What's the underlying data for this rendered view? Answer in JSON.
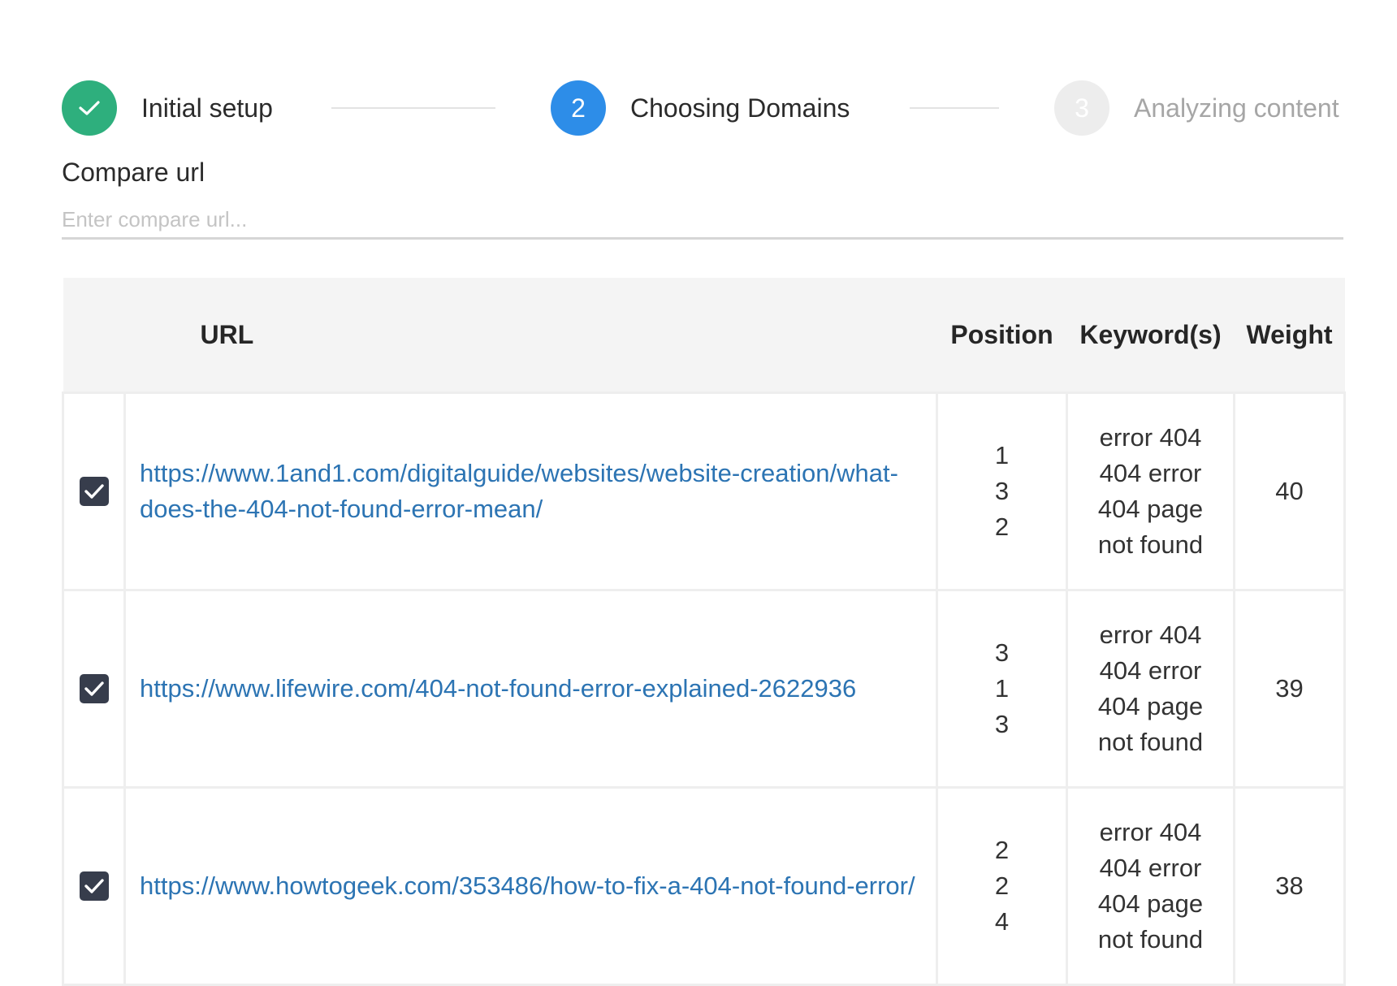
{
  "stepper": {
    "steps": [
      {
        "number": "1",
        "label": "Initial setup",
        "state": "done"
      },
      {
        "number": "2",
        "label": "Choosing Domains",
        "state": "active"
      },
      {
        "number": "3",
        "label": "Analyzing content",
        "state": "pending"
      }
    ]
  },
  "compare": {
    "label": "Compare url",
    "placeholder": "Enter compare url...",
    "value": ""
  },
  "table": {
    "headers": {
      "url": "URL",
      "position": "Position",
      "keywords": "Keyword(s)",
      "weight": "Weight"
    },
    "rows": [
      {
        "checked": true,
        "url": "https://www.1and1.com/digitalguide/websites/website-creation/what-does-the-404-not-found-error-mean/",
        "positions": [
          "1",
          "3",
          "2"
        ],
        "keywords": [
          "error 404",
          "404 error",
          "404 page",
          "not found"
        ],
        "weight": "40"
      },
      {
        "checked": true,
        "url": "https://www.lifewire.com/404-not-found-error-explained-2622936",
        "positions": [
          "3",
          "1",
          "3"
        ],
        "keywords": [
          "error 404",
          "404 error",
          "404 page",
          "not found"
        ],
        "weight": "39"
      },
      {
        "checked": true,
        "url": "https://www.howtogeek.com/353486/how-to-fix-a-404-not-found-error/",
        "positions": [
          "2",
          "2",
          "4"
        ],
        "keywords": [
          "error 404",
          "404 error",
          "404 page",
          "not found"
        ],
        "weight": "38"
      }
    ]
  },
  "colors": {
    "step_done": "#2eaf7d",
    "step_active": "#2d8de8",
    "step_pending": "#ededed",
    "link": "#2c74b3",
    "checkbox": "#373d4c",
    "header_bg": "#f4f4f4"
  },
  "icons": {
    "step_done": "check-icon",
    "row_checkbox": "checkbox-checked-icon"
  }
}
